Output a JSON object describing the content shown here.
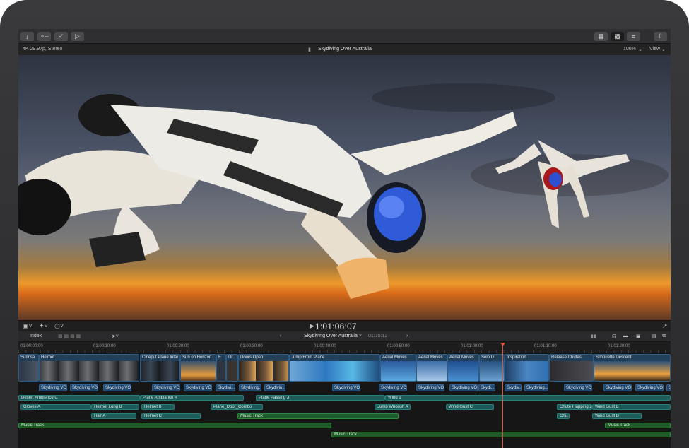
{
  "toolbar": {
    "left_icons": [
      "import-icon",
      "key-icon",
      "check-icon",
      "tag-icon"
    ],
    "right_icons": [
      "browser-layout-icon",
      "viewer-layout-icon",
      "inspector-layout-icon",
      "share-icon"
    ]
  },
  "viewer": {
    "format": "4K 29.97p, Stereo",
    "title": "Skydiving Over Australia",
    "zoom": "100%",
    "view_label": "View"
  },
  "transport": {
    "timecode": "1:01:06:07"
  },
  "timeline_header": {
    "index_label": "Index",
    "project_title": "Skydiving Over Australia",
    "duration": "01:35:12"
  },
  "ruler": {
    "ticks": [
      "01:00:00:00",
      "01:00:10:00",
      "01:00:20:00",
      "01:00:30:00",
      "01:00:40:00",
      "01:00:50:00",
      "01:01:00:00",
      "01:01:10:00",
      "01:01:20:00"
    ]
  },
  "clips": [
    {
      "name": "Sunrise"
    },
    {
      "name": "Helmet"
    },
    {
      "name": "Cineput Plane Interior"
    },
    {
      "name": "Sun on Horizon"
    },
    {
      "name": "E..."
    },
    {
      "name": "Dr..."
    },
    {
      "name": "Doors Open"
    },
    {
      "name": "Jump From Plane"
    },
    {
      "name": "Aerial Moves"
    },
    {
      "name": "Aerial Moves"
    },
    {
      "name": "Aerial Moves"
    },
    {
      "name": "Solo D..."
    },
    {
      "name": "Inspiration"
    },
    {
      "name": "Release Chutes"
    },
    {
      "name": "Silhouette Descent"
    }
  ],
  "voiceovers": [
    "Skydiving VO",
    "Skydiving VO",
    "Skydiving VO",
    "Skydiving VO",
    "Skydiving VO",
    "Skydivi...",
    "Skydiving...",
    "Skydivin...",
    "Skydiving VO",
    "Skydiving VO",
    "Skydiving VO",
    "Skydiving VO",
    "Skydi...",
    "Skydiv...",
    "Skydiving...",
    "Skydiving VO",
    "Skydiving VO",
    "Skydiving VO",
    "Skydiving VO"
  ],
  "audio": [
    "Desert Ambience C",
    "Plane Ambiance A",
    "Plane Passing 3",
    "Wind 1",
    "Gloves A",
    "Helmet Long B",
    "Helmet B",
    "Plane_Door_Combo",
    "Jump Whoosh A",
    "Wind Gust C",
    "Chute Flapping 2",
    "Wind Gust B",
    "Hair A",
    "Helmet C",
    "Chu...",
    "Wind Gust D"
  ],
  "music": [
    "Music Track",
    "Music Track",
    "Music Track"
  ],
  "colors": {
    "accent": "#e0523a",
    "video_clip": "#23405a",
    "audio_clip": "#1d5a5a",
    "music_clip": "#1f5b2a"
  }
}
